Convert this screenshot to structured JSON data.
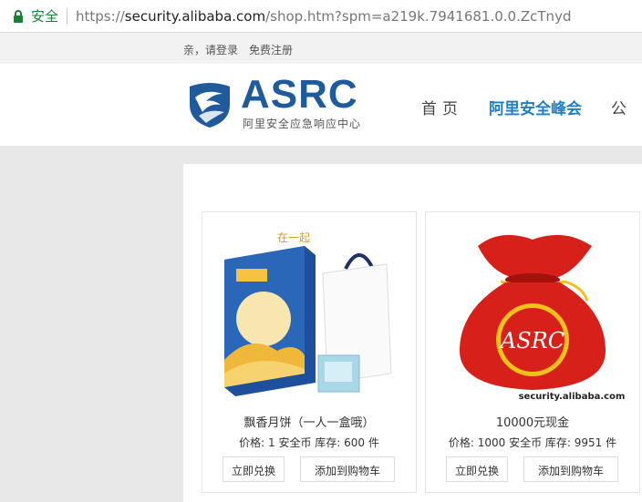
{
  "browser": {
    "secure_label": "安全",
    "url_scheme": "https://",
    "url_host": "security.alibaba.com",
    "url_path": "/shop.htm?spm=a219k.7941681.0.0.ZcTnyd"
  },
  "topbar": {
    "login_text": "亲，请登录",
    "register_text": "免费注册"
  },
  "header": {
    "logo_text": "ASRC",
    "logo_subtitle": "阿里安全应急响应中心",
    "nav": [
      "首页",
      "阿里安全峰会",
      "公"
    ]
  },
  "products": [
    {
      "title": "飘香月饼（一人一盒哦）",
      "price_label": "价格: 1 安全币 库存: 600 件",
      "redeem_label": "立即兑换",
      "cart_label": "添加到购物车"
    },
    {
      "title": "10000元现金",
      "price_label": "价格: 1000 安全币 库存: 9951 件",
      "redeem_label": "立即兑换",
      "cart_label": "添加到购物车",
      "image_bag_text": "ASRC",
      "image_caption": "security.alibaba.com"
    }
  ],
  "colors": {
    "brand_blue": "#1e5a9c",
    "active_nav": "#1f7fc6",
    "secure_green": "#188038",
    "bag_red": "#d8201a"
  }
}
